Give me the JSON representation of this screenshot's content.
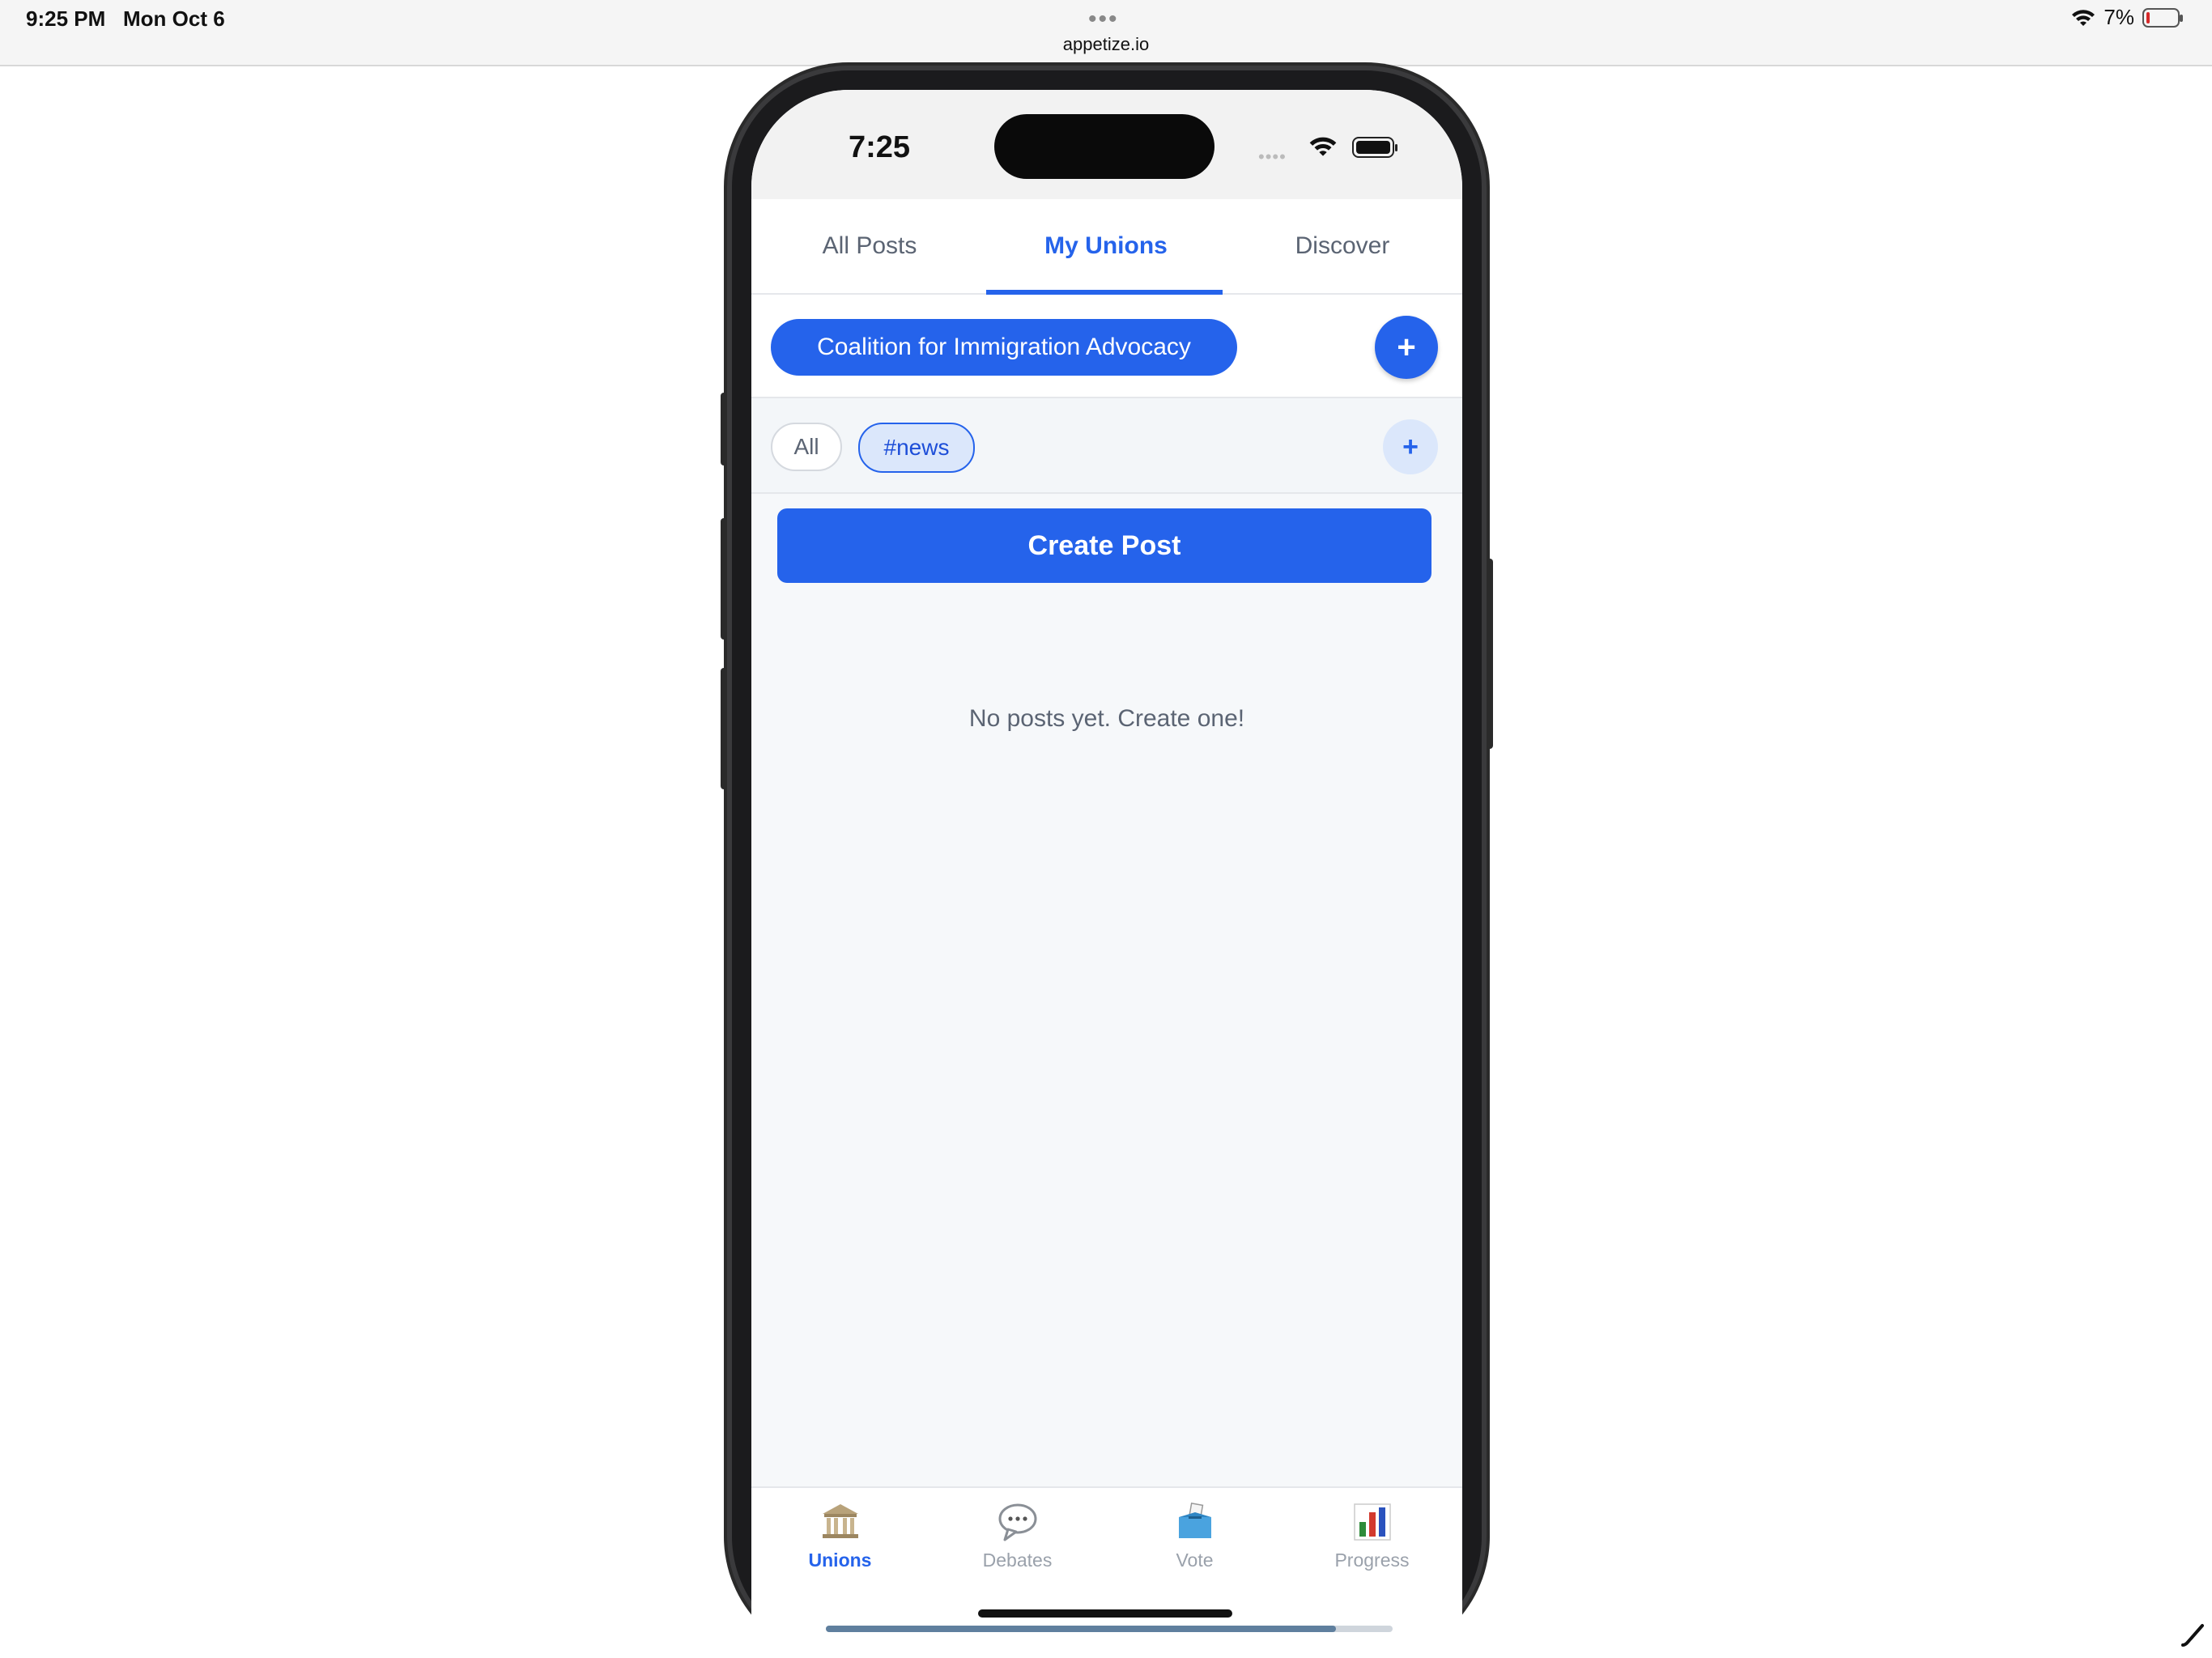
{
  "ipad_status": {
    "time": "9:25 PM",
    "date": "Mon Oct 6",
    "dots": "•••",
    "url": "appetize.io",
    "battery_pct": "7%"
  },
  "phone_status": {
    "time": "7:25",
    "signal": "••••"
  },
  "tabs": [
    {
      "label": "All Posts",
      "active": false
    },
    {
      "label": "My Unions",
      "active": true
    },
    {
      "label": "Discover",
      "active": false
    }
  ],
  "union": {
    "selected": "Coalition for Immigration Advocacy",
    "add_label": "+"
  },
  "channels": {
    "all_label": "All",
    "news_label": "#news",
    "add_label": "+"
  },
  "create_post_label": "Create Post",
  "empty_message": "No posts yet. Create one!",
  "bottom_nav": [
    {
      "label": "Unions",
      "icon": "classical-building-icon",
      "active": true
    },
    {
      "label": "Debates",
      "icon": "speech-bubble-icon",
      "active": false
    },
    {
      "label": "Vote",
      "icon": "ballot-box-icon",
      "active": false
    },
    {
      "label": "Progress",
      "icon": "bar-chart-icon",
      "active": false
    }
  ],
  "colors": {
    "accent": "#2563eb",
    "accent_light": "#dbe7fb",
    "muted_text": "#5b6473"
  }
}
